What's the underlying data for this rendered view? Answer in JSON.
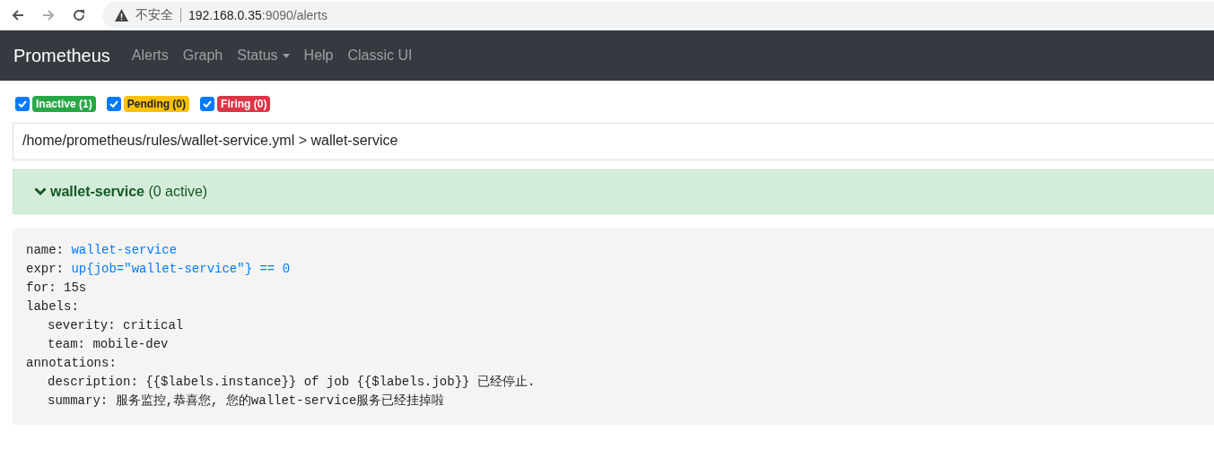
{
  "browser": {
    "security_label": "不安全",
    "url_host": "192.168.0.35",
    "url_rest": ":9090/alerts"
  },
  "navbar": {
    "brand": "Prometheus",
    "items": [
      {
        "label": "Alerts",
        "dropdown": false
      },
      {
        "label": "Graph",
        "dropdown": false
      },
      {
        "label": "Status",
        "dropdown": true
      },
      {
        "label": "Help",
        "dropdown": false
      },
      {
        "label": "Classic UI",
        "dropdown": false
      }
    ]
  },
  "filters": [
    {
      "label": "Inactive (1)",
      "checked": true,
      "color": "#28a745"
    },
    {
      "label": "Pending (0)",
      "checked": true,
      "color": "#ffc107"
    },
    {
      "label": "Firing (0)",
      "checked": true,
      "color": "#dc3545"
    }
  ],
  "rule_file": "/home/prometheus/rules/wallet-service.yml > wallet-service",
  "alert_group": {
    "name": "wallet-service",
    "count": "(0 active)",
    "expanded": true
  },
  "rule": [
    {
      "key": "name:",
      "value": "wallet-service",
      "highlight": true
    },
    {
      "key": "expr:",
      "value": "up{job=\"wallet-service\"} == 0",
      "highlight": true
    },
    {
      "key": "for:",
      "value": "15s",
      "highlight": false
    },
    {
      "key": "labels:",
      "children": [
        {
          "key": "severity:",
          "value": "critical",
          "highlight": false
        },
        {
          "key": "team:",
          "value": "mobile-dev",
          "highlight": false
        }
      ]
    },
    {
      "key": "annotations:",
      "children": [
        {
          "key": "description:",
          "value": "{{$labels.instance}} of job {{$labels.job}} 已经停止.",
          "highlight": false
        },
        {
          "key": "summary:",
          "value": "服务监控,恭喜您, 您的wallet-service服务已经挂掉啦",
          "highlight": false
        }
      ]
    }
  ]
}
